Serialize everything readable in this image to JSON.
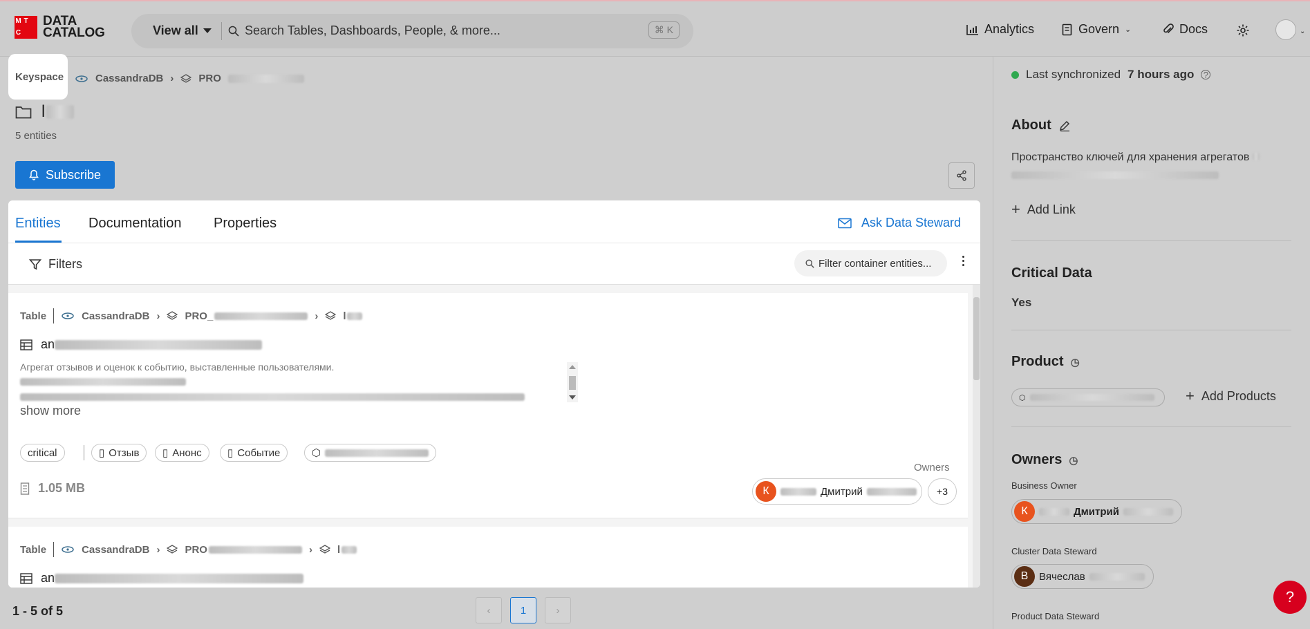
{
  "brand": {
    "logo_letters": [
      "М",
      "Т",
      "С"
    ],
    "line1": "DATA",
    "line2": "CATALOG"
  },
  "search": {
    "scope": "View all",
    "placeholder": "Search Tables, Dashboards, People, & more...",
    "shortcut": "⌘ K"
  },
  "nav": {
    "analytics": "Analytics",
    "govern": "Govern",
    "docs": "Docs"
  },
  "header": {
    "type_label": "Keyspace",
    "breadcrumb": [
      "CassandraDB",
      "PRO"
    ],
    "title": "l",
    "entities_count": "5 entities",
    "subscribe": "Subscribe"
  },
  "tabs": {
    "entities": "Entities",
    "documentation": "Documentation",
    "properties": "Properties",
    "ask_steward": "Ask Data Steward"
  },
  "filters": {
    "label": "Filters",
    "placeholder": "Filter container entities..."
  },
  "cards": [
    {
      "type": "Table",
      "breadcrumb": [
        "CassandraDB",
        "PRO_",
        "l"
      ],
      "title": "an",
      "description": "Агрегат отзывов и оценок к событию, выставленные пользователями.",
      "show_more": "show more",
      "tags": [
        "critical",
        "Отзыв",
        "Анонс",
        "Событие"
      ],
      "size": "1.05 MB",
      "owners_label": "Owners",
      "owner": {
        "initial": "К",
        "name": "Дмитрий",
        "color": "#e8531e"
      },
      "more_owners": "+3"
    },
    {
      "type": "Table",
      "breadcrumb": [
        "CassandraDB",
        "PRO",
        "l"
      ],
      "title": "an"
    }
  ],
  "pagination": {
    "range": "1 - 5 of 5",
    "current": "1",
    "prev": "‹",
    "next": "›"
  },
  "sidebar": {
    "sync_prefix": "Last synchronized",
    "sync_time": "7 hours ago",
    "about_title": "About",
    "about_text": "Пространство ключей для хранения агрегатов",
    "add_link": "Add Link",
    "critical_title": "Critical Data",
    "critical_value": "Yes",
    "product_title": "Product",
    "add_products": "Add Products",
    "owners_title": "Owners",
    "business_owner_label": "Business Owner",
    "business_owner": {
      "initial": "К",
      "name": "Дмитрий",
      "color": "#e8531e"
    },
    "cluster_steward_label": "Cluster Data Steward",
    "cluster_steward": {
      "initial": "В",
      "name": "Вячеслав",
      "color": "#5b2e14"
    },
    "product_steward_label": "Product Data Steward"
  },
  "help": "?"
}
